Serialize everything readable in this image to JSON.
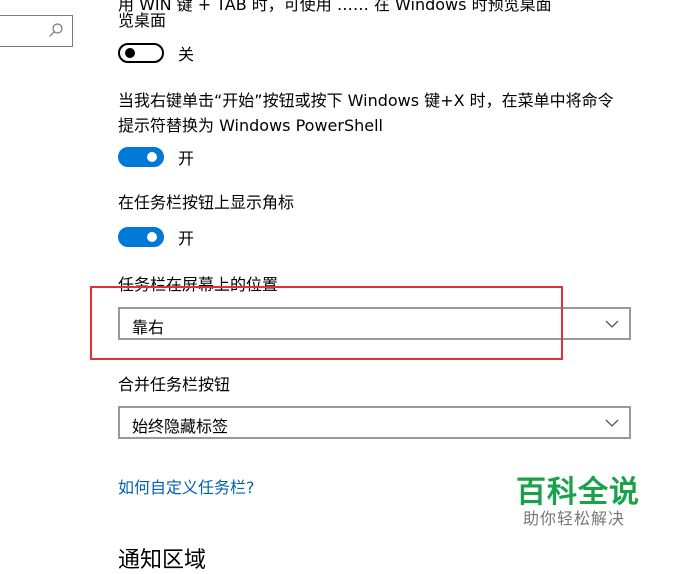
{
  "search": {
    "icon": "search-icon"
  },
  "settings": {
    "cut_top_line": "用 WIN 键 + TAB 时，可使用 …… 在 Windows 时预览桌面",
    "peek_desktop_line2": "览桌面",
    "peek_toggle_label": "关",
    "powershell_text": "当我右键单击“开始”按钮或按下 Windows 键+X 时，在菜单中将命令提示符替换为 Windows PowerShell",
    "powershell_toggle_label": "开",
    "badges_text": "在任务栏按钮上显示角标",
    "badges_toggle_label": "开",
    "position_label": "任务栏在屏幕上的位置",
    "position_value": "靠右",
    "combine_label": "合并任务栏按钮",
    "combine_value": "始终隐藏标签",
    "customize_link": "如何自定义任务栏?",
    "notification_area_title": "通知区域"
  },
  "watermark": {
    "title": "百科全说",
    "subtitle": "助你轻松解决"
  },
  "colors": {
    "accent": "#0078d7",
    "highlight_box": "#e0303a",
    "watermark": "#1aa14a"
  }
}
